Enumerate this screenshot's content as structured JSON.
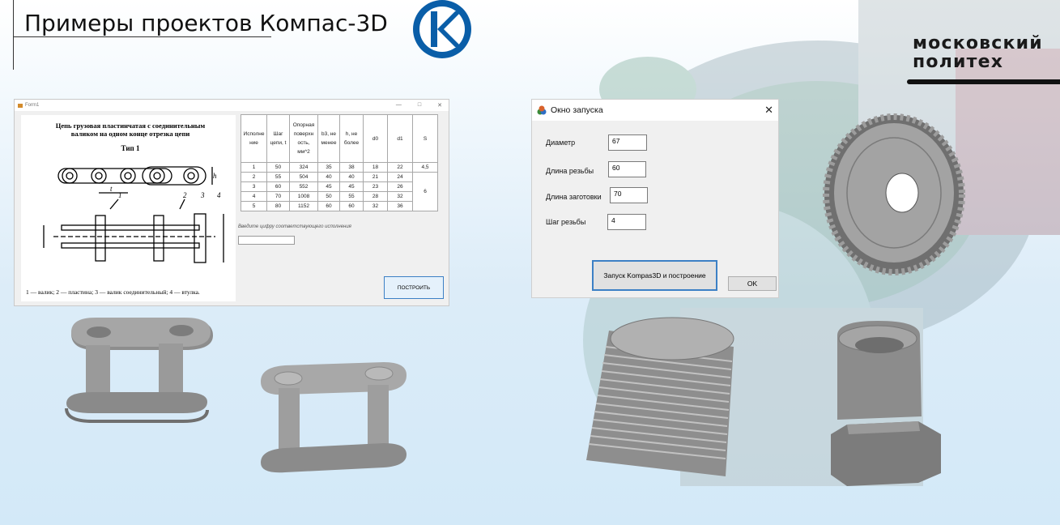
{
  "slide": {
    "title": "Примеры проектов Компас-3D",
    "brand_line1": "московский",
    "brand_line2": "политех"
  },
  "colors": {
    "accent": "#0a5ea8",
    "brand_bar": "#111111",
    "button_border": "#3c80c5"
  },
  "form1": {
    "window_title": "Form1",
    "controls": [
      "—",
      "□",
      "✕"
    ],
    "drawing_title_line1": "Цепь грузовая пластинчатая с соединительным",
    "drawing_title_line2": "валиком на одном конце отрезка цепи",
    "drawing_type": "Тип 1",
    "drawing_caption": "1 — валик; 2 — пластина; 3 — валик соединительный; 4 — втулка.",
    "table": {
      "headers": [
        "Исполне ние",
        "Шаг цепи, t",
        "Опорная поверхн ость, мм^2",
        "b3, не менее",
        "h, не более",
        "d0",
        "d1",
        "S"
      ],
      "rows": [
        [
          "1",
          "50",
          "324",
          "35",
          "38",
          "18",
          "22",
          "4,5"
        ],
        [
          "2",
          "55",
          "504",
          "40",
          "40",
          "21",
          "24",
          ""
        ],
        [
          "3",
          "60",
          "552",
          "45",
          "45",
          "23",
          "26",
          "6"
        ],
        [
          "4",
          "70",
          "1008",
          "50",
          "55",
          "28",
          "32",
          ""
        ],
        [
          "5",
          "80",
          "1152",
          "60",
          "60",
          "32",
          "36",
          ""
        ]
      ]
    },
    "hint": "Введите цифру соответствующего исполнения",
    "input_value": "",
    "build_button": "ПОСТРОИТЬ"
  },
  "launch_window": {
    "title": "Окно запуска",
    "close_glyph": "✕",
    "fields": [
      {
        "label": "Диаметр",
        "value": "67"
      },
      {
        "label": "Длина резьбы",
        "value": "60"
      },
      {
        "label": "Длина заготовки",
        "value": "70"
      },
      {
        "label": "Шаг резьбы",
        "value": "4"
      }
    ],
    "launch_button": "Запуск Kompas3D и построение",
    "ok_button": "OK"
  }
}
